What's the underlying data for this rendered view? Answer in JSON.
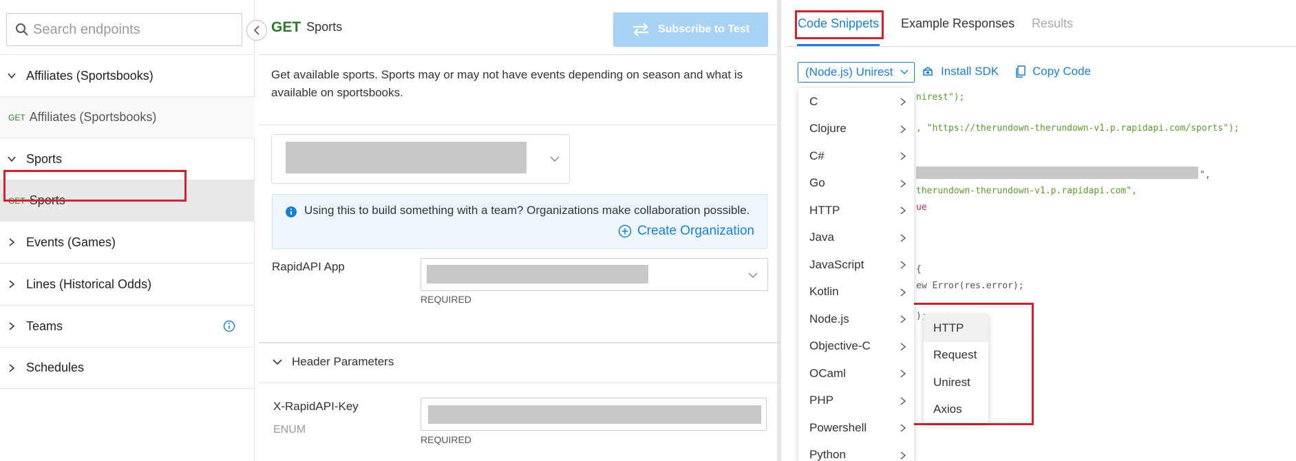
{
  "sidebar": {
    "search_placeholder": "Search endpoints",
    "items": [
      {
        "type": "group",
        "label": "Affiliates (Sportsbooks)"
      },
      {
        "type": "endpoint",
        "method": "GET",
        "label": "Affiliates (Sportsbooks)"
      },
      {
        "type": "group",
        "label": "Sports"
      },
      {
        "type": "endpoint",
        "method": "GET",
        "label": "Sports",
        "active": true
      },
      {
        "type": "group",
        "label": "Events (Games)"
      },
      {
        "type": "group",
        "label": "Lines (Historical Odds)"
      },
      {
        "type": "group",
        "label": "Teams"
      },
      {
        "type": "group",
        "label": "Schedules"
      }
    ]
  },
  "middle": {
    "method": "GET",
    "title": "Sports",
    "subscribe_label": "Subscribe to Test",
    "description": "Get available sports. Sports may or may not have events depending on season and what is available on sportsbooks.",
    "banner_text": "Using this to build something with a team? Organizations make collaboration possible.",
    "banner_link": "Create Organization",
    "app_label": "RapidAPI App",
    "required_label": "REQUIRED",
    "header_params_label": "Header Parameters",
    "key_label": "X-RapidAPI-Key",
    "key_type": "ENUM"
  },
  "right": {
    "tabs": [
      "Code Snippets",
      "Example Responses",
      "Results"
    ],
    "active_tab": "Code Snippets",
    "language_selected": "(Node.js) Unirest",
    "install_sdk": "Install SDK",
    "copy_code": "Copy Code",
    "code_lines": [
      {
        "text": "nirest\");",
        "kind": "str"
      },
      {
        "text": ", \"https://therundown-therundown-v1.p.rapidapi.com/sports\");",
        "kind": "str"
      },
      {
        "text": "\",",
        "kind": "plain"
      },
      {
        "text": "therundown-therundown-v1.p.rapidapi.com\",",
        "kind": "str"
      },
      {
        "text": "ue",
        "kind": "kw"
      },
      {
        "text": "{",
        "kind": "plain"
      },
      {
        "text": "ew Error(res.error);",
        "kind": "plain"
      },
      {
        "text": ");",
        "kind": "plain"
      }
    ],
    "languages": [
      "C",
      "Clojure",
      "C#",
      "Go",
      "HTTP",
      "Java",
      "JavaScript",
      "Kotlin",
      "Node.js",
      "Objective-C",
      "OCaml",
      "PHP",
      "Powershell",
      "Python"
    ],
    "node_submenu": [
      "HTTP",
      "Request",
      "Unirest",
      "Axios"
    ]
  },
  "colors": {
    "accent": "#1a7fd4",
    "get_green": "#2a7a2a",
    "highlight_red": "#d9202a",
    "subscribe_bg": "#a8d3f5"
  }
}
